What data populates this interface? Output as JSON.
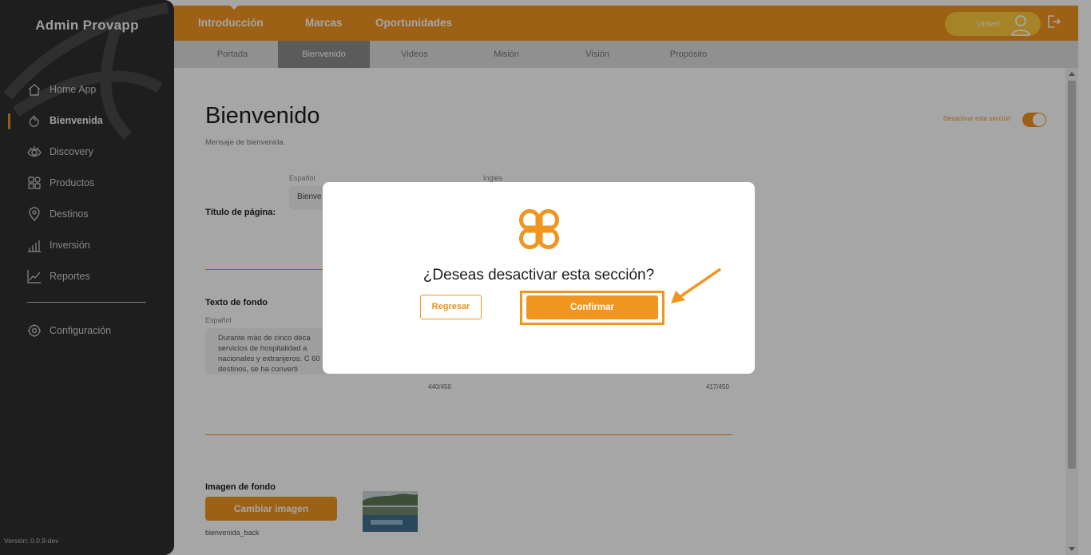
{
  "sidebar": {
    "brand": "Admin Provapp",
    "items": [
      {
        "label": "Home App",
        "icon": "house-icon"
      },
      {
        "label": "Bienvenida",
        "icon": "waving-hand-icon",
        "active": true
      },
      {
        "label": "Discovery",
        "icon": "eye-icon"
      },
      {
        "label": "Productos",
        "icon": "grid-icon"
      },
      {
        "label": "Destinos",
        "icon": "location-pin-icon"
      },
      {
        "label": "Inversión",
        "icon": "bar-chart-icon"
      },
      {
        "label": "Reportes",
        "icon": "line-chart-icon"
      }
    ],
    "settings": {
      "label": "Configuración",
      "icon": "gear-icon"
    },
    "version": "Versión: 0.0.9-dev"
  },
  "topbar": {
    "nav": [
      "Introducción",
      "Marcas",
      "Oportunidades"
    ],
    "active_nav": "Introducción",
    "user_name": "Umvel"
  },
  "subtabs": {
    "items": [
      "Portada",
      "Bienvenido",
      "Videos",
      "Misión",
      "Visión",
      "Propósito"
    ],
    "active": "Bienvenido"
  },
  "page": {
    "title": "Bienvenido",
    "subtitle": "Mensaje de bienvenida.",
    "toggle_label": "Desactivar esta sección",
    "toggle_on": true,
    "page_title_field": {
      "label": "Título de página:",
      "lang_es": "Español",
      "lang_en": "Inglés",
      "value_es": "Bienve"
    },
    "background_text": {
      "label": "Texto de fondo",
      "lang_es": "Español",
      "value_es": "Durante más de cinco déca servicios de hospitalidad a nacionales y extranjeros. C 60 destinos, se ha converti",
      "counter_es": "440/450",
      "counter_en": "417/450"
    },
    "background_image": {
      "label": "Imagen de fondo",
      "button": "Cambiar imagen",
      "filename": "bienvenida_back"
    }
  },
  "modal": {
    "question": "¿Deseas desactivar esta sección?",
    "back_button": "Regresar",
    "confirm_button": "Confirmar"
  },
  "colors": {
    "accent": "#f0961f",
    "sidebar_bg": "#2f2f2f",
    "user_pill": "#ffc93d"
  }
}
